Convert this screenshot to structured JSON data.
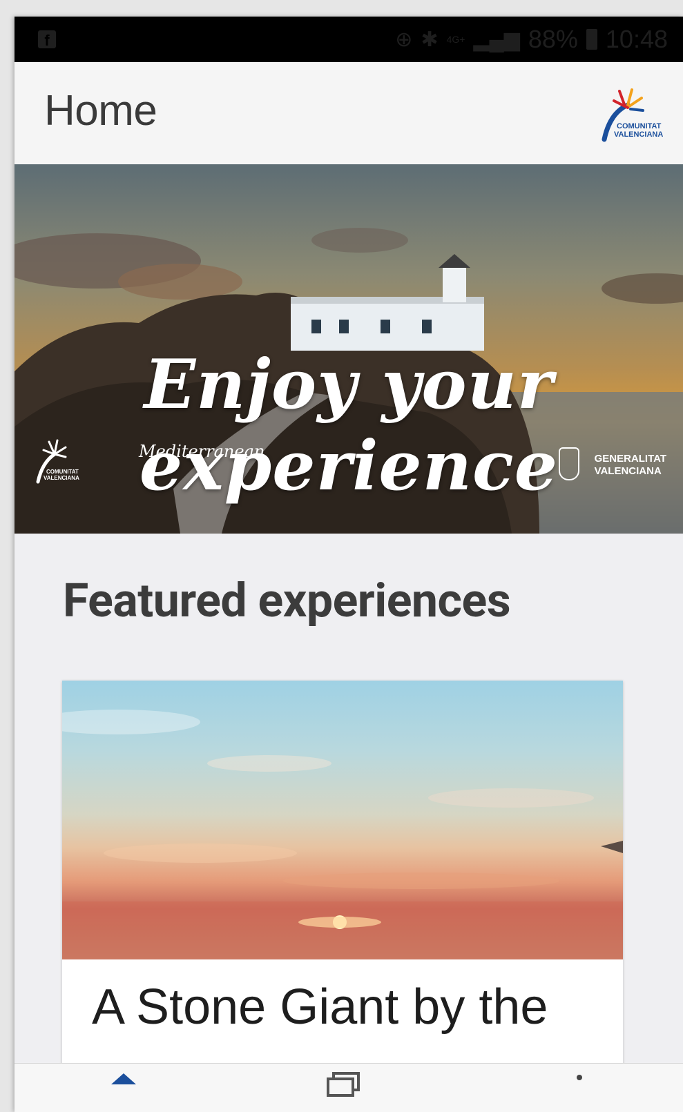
{
  "status_bar": {
    "battery": "88%",
    "time": "10:48",
    "network": "4G+"
  },
  "app_bar": {
    "title": "Home",
    "logo_text_line1": "COMUNITAT",
    "logo_text_line2": "VALENCIANA"
  },
  "hero": {
    "line1": "Enjoy your",
    "line2": "experience",
    "left_logo_line1": "COMUNITAT",
    "left_logo_line2": "VALENCIANA",
    "tagline": "Mediterranean",
    "right_logo_line1": "GENERALITAT",
    "right_logo_line2": "VALENCIANA"
  },
  "featured": {
    "section_title": "Featured experiences",
    "cards": [
      {
        "title": "A Stone Giant by the"
      }
    ]
  },
  "bottom_nav": {
    "items": [
      {
        "icon": "home-icon"
      },
      {
        "icon": "cards-icon"
      },
      {
        "icon": "more-icon"
      }
    ]
  },
  "colors": {
    "app_bar_bg": "#f5f5f5",
    "page_bg": "#efeff2",
    "title_text": "#3a3a3a",
    "logo_blue": "#1b4f9c",
    "logo_orange": "#f4a21c",
    "logo_red": "#d2232a"
  }
}
